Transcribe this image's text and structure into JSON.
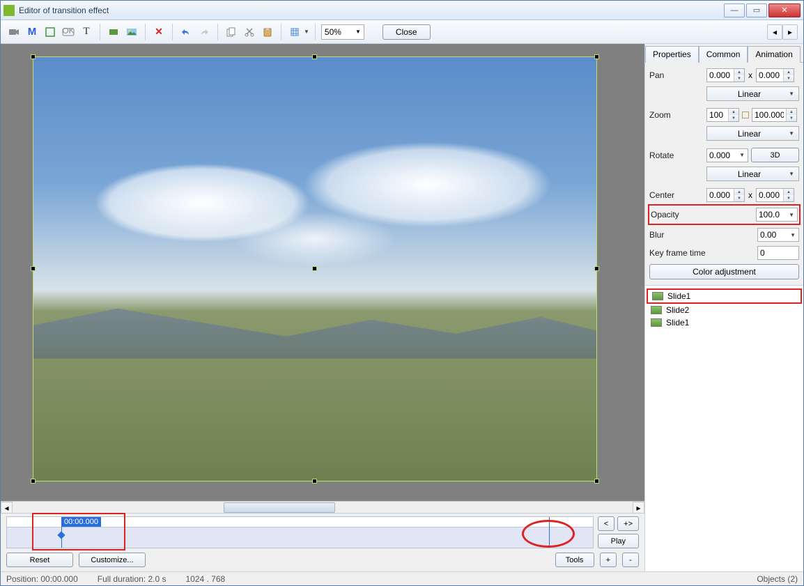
{
  "window": {
    "title": "Editor of transition effect"
  },
  "toolbar": {
    "zoom": "50%",
    "close_label": "Close"
  },
  "tabs": {
    "properties": "Properties",
    "common": "Common",
    "animation": "Animation",
    "active": "animation"
  },
  "animation": {
    "pan_label": "Pan",
    "pan_x": "0.000",
    "pan_y": "0.000",
    "pan_interp": "Linear",
    "zoom_label": "Zoom",
    "zoom_a": "100",
    "zoom_b": "100.000",
    "zoom_interp": "Linear",
    "rotate_label": "Rotate",
    "rotate_v": "0.000",
    "rotate_3d": "3D",
    "rotate_interp": "Linear",
    "center_label": "Center",
    "center_x": "0.000",
    "center_y": "0.000",
    "opacity_label": "Opacity",
    "opacity_v": "100.0",
    "blur_label": "Blur",
    "blur_v": "0.00",
    "keyframe_label": "Key frame time",
    "keyframe_v": "0",
    "coloradj_label": "Color adjustment",
    "x_label": "x"
  },
  "slides": {
    "items": [
      "Slide1",
      "Slide2",
      "Slide1"
    ]
  },
  "timeline": {
    "time_label": "00:00.000",
    "prev": "<",
    "next": "+>",
    "play": "Play",
    "reset": "Reset",
    "customize": "Customize...",
    "tools": "Tools",
    "plus": "+",
    "minus": "-"
  },
  "status": {
    "position": "Position:  00:00.000",
    "duration": "Full duration:  2.0 s",
    "dims": "1024 . 768",
    "objects": "Objects (2)"
  }
}
